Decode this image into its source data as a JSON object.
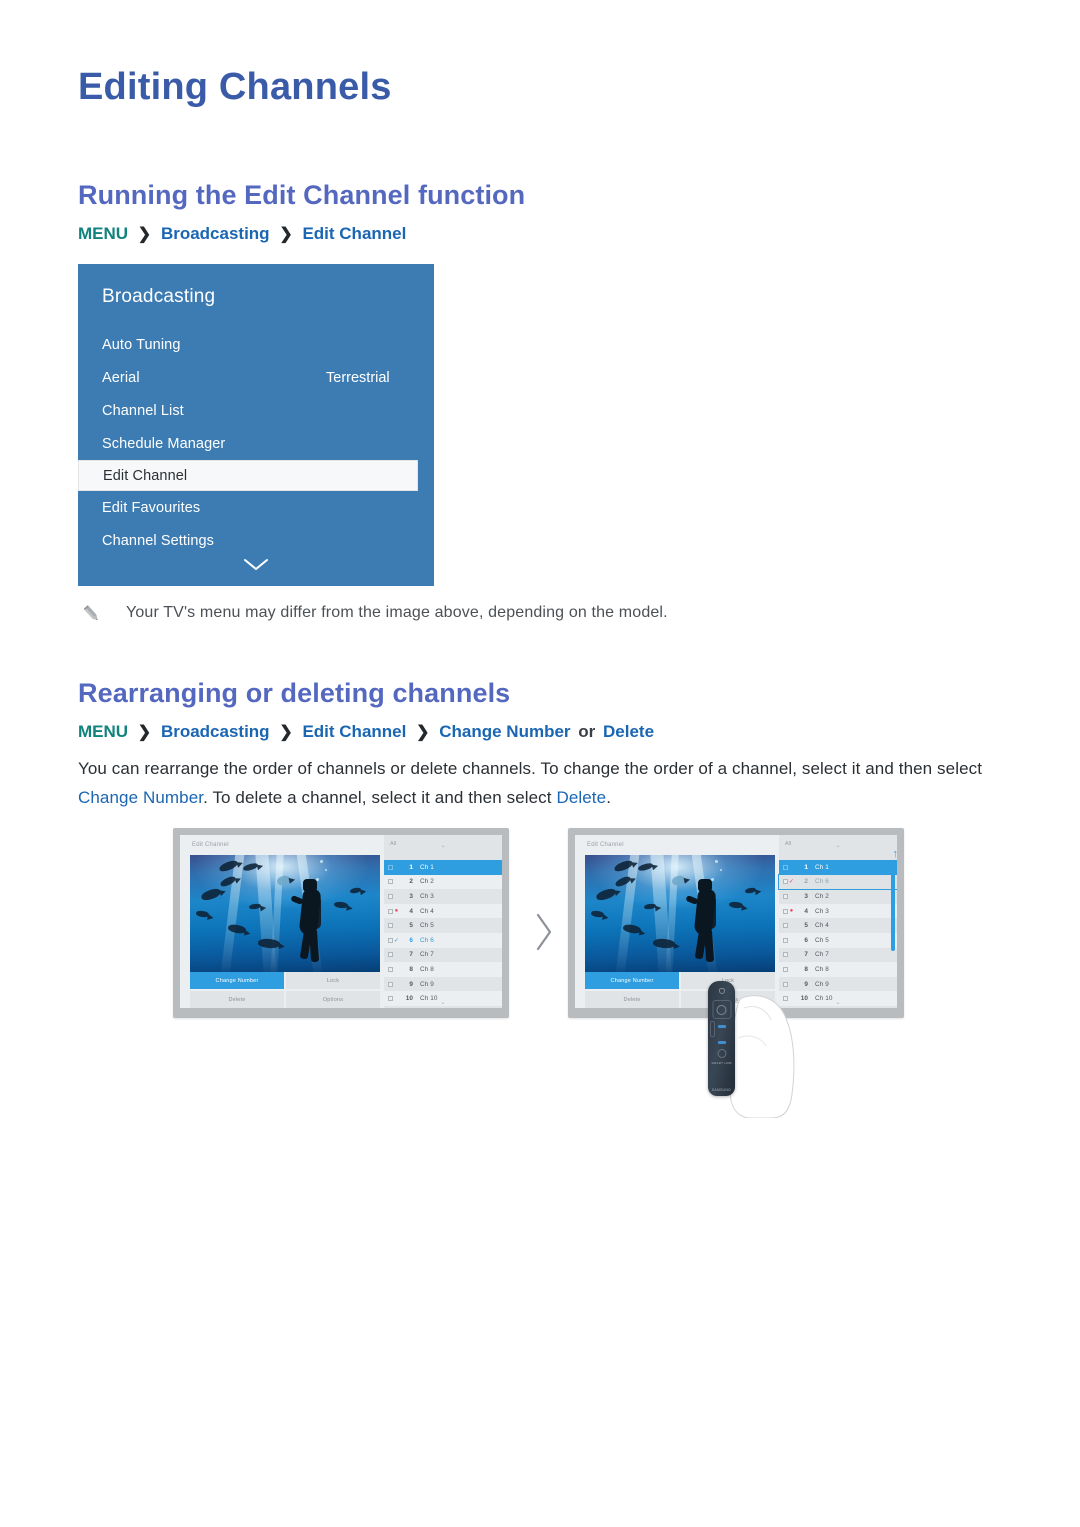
{
  "page": {
    "title": "Editing Channels"
  },
  "sections": [
    {
      "id": "running-edit-channel",
      "heading": "Running the Edit Channel function",
      "breadcrumb": {
        "menu": "MENU",
        "sep": "❯",
        "items": [
          "Broadcasting",
          "Edit Channel"
        ]
      }
    },
    {
      "id": "rearranging-deleting",
      "heading": "Rearranging or deleting channels",
      "breadcrumb": {
        "menu": "MENU",
        "sep": "❯",
        "items": [
          "Broadcasting",
          "Edit Channel",
          "Change Number"
        ],
        "conjunction": "or",
        "last": "Delete"
      }
    }
  ],
  "tv_menu": {
    "title": "Broadcasting",
    "items": [
      {
        "label": "Auto Tuning",
        "value": ""
      },
      {
        "label": "Aerial",
        "value": "Terrestrial"
      },
      {
        "label": "Channel List",
        "value": ""
      },
      {
        "label": "Schedule Manager",
        "value": ""
      },
      {
        "label": "Edit Channel",
        "value": "",
        "selected": true
      },
      {
        "label": "Edit Favourites",
        "value": ""
      },
      {
        "label": "Channel Settings",
        "value": ""
      }
    ],
    "more_icon": "chevron-down-icon"
  },
  "note": {
    "icon": "pencil-icon",
    "text": "Your TV's menu may differ from the image above, depending on the model."
  },
  "paragraph": {
    "part1": "You can rearrange the order of channels or delete channels. To change the order of a channel, select it and then select ",
    "link1": "Change Number",
    "part2": ". To delete a channel, select it and then select ",
    "link2": "Delete",
    "part3": "."
  },
  "figure": {
    "arrow_icon": "chevron-right-icon",
    "tv_before": {
      "screen_title": "Edit Channel",
      "list_header": "All",
      "buttons": [
        {
          "label": "Change Number",
          "active": true
        },
        {
          "label": "Lock",
          "active": false
        },
        {
          "label": "Delete",
          "active": false
        },
        {
          "label": "Options",
          "active": false
        }
      ],
      "channels": [
        {
          "num": "1",
          "name": "Ch 1",
          "state": "selected"
        },
        {
          "num": "2",
          "name": "Ch 2",
          "state": "normal"
        },
        {
          "num": "3",
          "name": "Ch 3",
          "state": "normal"
        },
        {
          "num": "4",
          "name": "Ch 4",
          "state": "dot"
        },
        {
          "num": "5",
          "name": "Ch 5",
          "state": "normal"
        },
        {
          "num": "6",
          "name": "Ch 6",
          "state": "checked"
        },
        {
          "num": "7",
          "name": "Ch 7",
          "state": "normal"
        },
        {
          "num": "8",
          "name": "Ch 8",
          "state": "normal"
        },
        {
          "num": "9",
          "name": "Ch 9",
          "state": "normal"
        },
        {
          "num": "10",
          "name": "Ch 10",
          "state": "normal"
        }
      ]
    },
    "tv_after": {
      "screen_title": "Edit Channel",
      "list_header": "All",
      "buttons": [
        {
          "label": "Change Number",
          "active": true
        },
        {
          "label": "Lock",
          "active": false
        },
        {
          "label": "Delete",
          "active": false
        },
        {
          "label": "Options",
          "active": false
        }
      ],
      "channels": [
        {
          "num": "1",
          "name": "Ch 1",
          "state": "selected"
        },
        {
          "num": "2",
          "name": "Ch 6",
          "state": "moving"
        },
        {
          "num": "3",
          "name": "Ch 2",
          "state": "normal"
        },
        {
          "num": "4",
          "name": "Ch 3",
          "state": "dot"
        },
        {
          "num": "5",
          "name": "Ch 4",
          "state": "normal"
        },
        {
          "num": "6",
          "name": "Ch 5",
          "state": "normal"
        },
        {
          "num": "7",
          "name": "Ch 7",
          "state": "normal"
        },
        {
          "num": "8",
          "name": "Ch 8",
          "state": "normal"
        },
        {
          "num": "9",
          "name": "Ch 9",
          "state": "normal"
        },
        {
          "num": "10",
          "name": "Ch 10",
          "state": "normal"
        }
      ],
      "remote": {
        "icon": "samsung-smart-remote",
        "brand": "SAMSUNG",
        "label": "SMART HUB"
      }
    }
  },
  "colors": {
    "page_title": "#3a5ba8",
    "section_title": "#5568c0",
    "breadcrumb_menu": "#11837f",
    "breadcrumb_item": "#1a66b3",
    "menu_panel": "#3d7cb2",
    "accent_blue": "#2f9ee0",
    "body_text": "#2a2f34",
    "note_text": "#4c5156"
  }
}
